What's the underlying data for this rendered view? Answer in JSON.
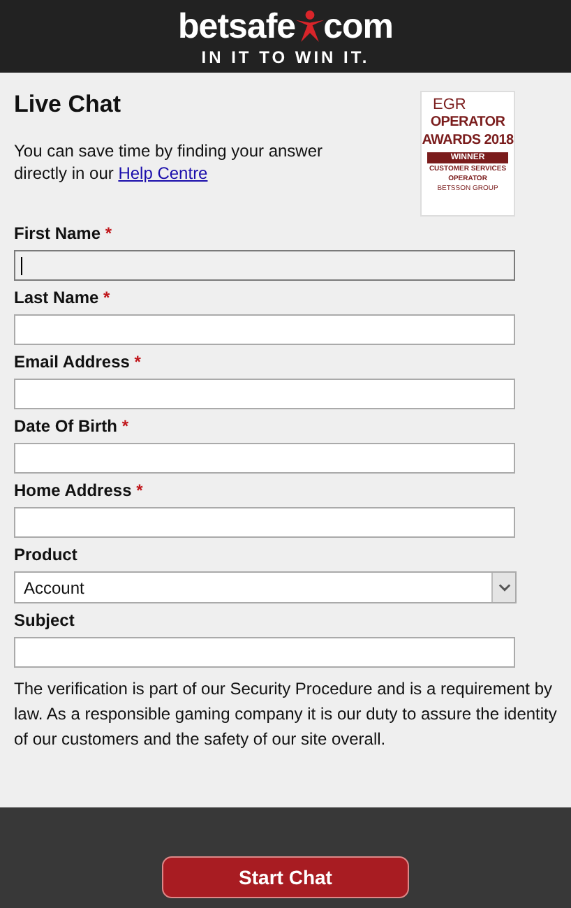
{
  "header": {
    "logo_left": "betsafe",
    "logo_right": "com",
    "tagline": "IN IT TO WIN IT."
  },
  "title": "Live Chat",
  "intro": {
    "text": "You can save time by finding your answer directly in our ",
    "link": "Help Centre"
  },
  "award": {
    "lines": [
      "EGR",
      "OPERATOR",
      "AWARDS 2018"
    ],
    "ribbon": "WINNER",
    "caption": [
      "CUSTOMER SERVICES",
      "OPERATOR"
    ],
    "group": "BETSSON GROUP"
  },
  "fields": [
    {
      "label": "First Name",
      "required_mark": "*",
      "kind": "text",
      "focused": true
    },
    {
      "label": "Last Name",
      "required_mark": "*",
      "kind": "text",
      "focused": false
    },
    {
      "label": "Email Address",
      "required_mark": "*",
      "kind": "text",
      "focused": false
    },
    {
      "label": "Date Of Birth",
      "required_mark": "*",
      "kind": "text",
      "focused": false
    },
    {
      "label": "Home Address",
      "required_mark": "*",
      "kind": "text",
      "focused": false
    },
    {
      "label": "Product",
      "kind": "select",
      "value": "Account"
    },
    {
      "label": "Subject",
      "kind": "text",
      "focused": false
    }
  ],
  "notice": "The verification is part of our Security Procedure and is a requirement by law. As a responsible gaming company it is our duty to assure the identity of our customers and the safety of our site overall.",
  "button": "Start Chat"
}
